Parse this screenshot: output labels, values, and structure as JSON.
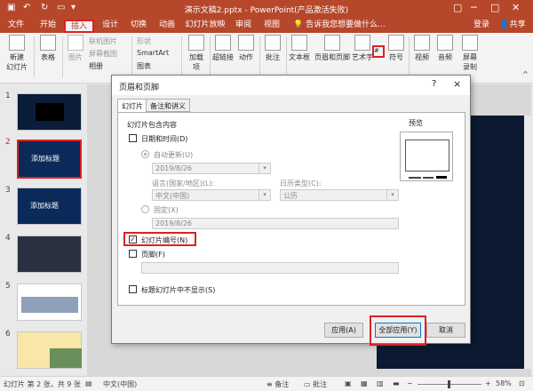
{
  "title": {
    "text": "演示文稿2.pptx - PowerPoint(产品激活失败)"
  },
  "user": {
    "login": "登录",
    "share": "共享"
  },
  "tabs": [
    "文件",
    "开始",
    "插入",
    "设计",
    "切换",
    "动画",
    "幻灯片放映",
    "审阅",
    "视图"
  ],
  "tell_me": "告诉我您想要做什么...",
  "ribbon": {
    "new_slide": "新建\n幻灯片",
    "table": "表格",
    "picture": "图片",
    "online_pictures": "联机图片",
    "screenshot": "屏幕截图",
    "album": "相册",
    "shapes": "形状",
    "smartart": "SmartArt",
    "chart": "图表",
    "addins": "加载\n项",
    "link": "超链接",
    "action": "动作",
    "comment": "批注",
    "textbox": "文本框",
    "header_footer": "页眉和页脚",
    "wordart": "艺术字",
    "symbol": "符号",
    "video": "视频",
    "audio": "音频",
    "screen_record": "屏幕\n录制"
  },
  "thumbnails": [
    {
      "num": "1",
      "text": ""
    },
    {
      "num": "2",
      "text": "添加标题"
    },
    {
      "num": "3",
      "text": "添加标题"
    },
    {
      "num": "4",
      "text": ""
    },
    {
      "num": "5",
      "text": ""
    },
    {
      "num": "6",
      "text": ""
    }
  ],
  "status": {
    "slide": "幻灯片 第 2 张，共 9 张",
    "lang": "中文(中国)",
    "notes": "备注",
    "comments": "批注",
    "zoom": "58%"
  },
  "dialog": {
    "title": "页眉和页脚",
    "help": "?",
    "close": "×",
    "tab_slide": "幻灯片",
    "tab_notes": "备注和讲义",
    "group_label": "幻灯片包含内容",
    "datetime": "日期和时间(D)",
    "auto_update": "自动更新(U)",
    "date_value": "2019/8/26",
    "language_label": "语言(国家/地区)(L):",
    "language_value": "中文(中国)",
    "calendar_label": "日历类型(C):",
    "calendar_value": "公历",
    "fixed": "固定(X)",
    "fixed_value": "2019/8/26",
    "slide_number": "幻灯片编号(N)",
    "slide_number_checked": "✓",
    "footer": "页脚(F)",
    "hide_title": "标题幻灯片中不显示(S)",
    "preview_label": "预览",
    "apply": "应用(A)",
    "apply_all": "全部应用(Y)",
    "cancel": "取消"
  },
  "colors": {
    "accent": "#b7472a",
    "highlight": "#e02020"
  }
}
